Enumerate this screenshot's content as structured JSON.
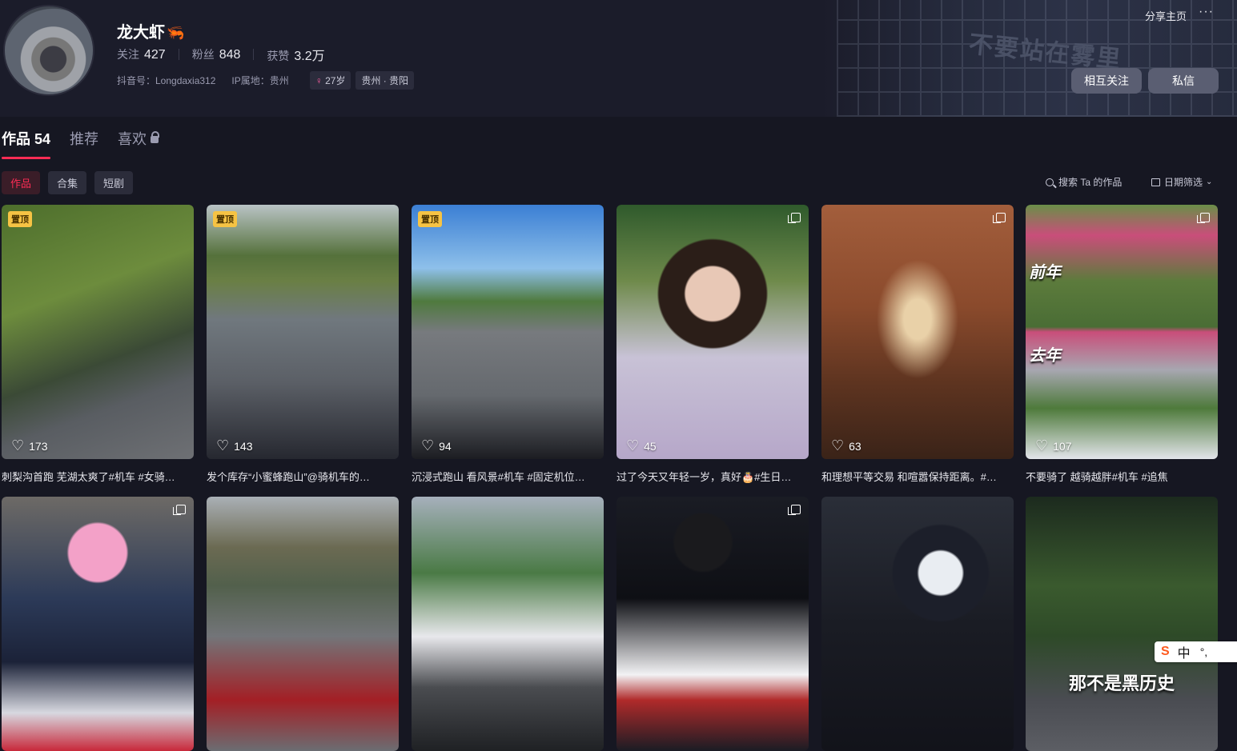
{
  "profile": {
    "name": "龙大虾",
    "following_label": "关注",
    "following": "427",
    "followers_label": "粉丝",
    "followers": "848",
    "likes_label": "获赞",
    "likes": "3.2万",
    "douyin_id": "抖音号：Longdaxia312",
    "ip": "IP属地：贵州",
    "age": "27岁",
    "location": "贵州 · 贵阳"
  },
  "banner": {
    "text": "不要站在雾里"
  },
  "header": {
    "share": "分享主页",
    "more": "···",
    "follow_button": "相互关注",
    "message_button": "私信"
  },
  "tabs": [
    {
      "label": "作品 54"
    },
    {
      "label": "推荐"
    },
    {
      "label": "喜欢"
    }
  ],
  "subtabs": [
    {
      "label": "作品"
    },
    {
      "label": "合集"
    },
    {
      "label": "短剧"
    }
  ],
  "search": {
    "label": "搜索 Ta 的作品"
  },
  "date_filter": {
    "label": "日期筛选"
  },
  "pin_label": "置顶",
  "videos": [
    {
      "likes": "173",
      "caption": "刺梨沟首跑 芜湖太爽了#机车 #女骑…"
    },
    {
      "likes": "143",
      "caption": "发个库存“小蜜蜂跑山”@骑机车的…"
    },
    {
      "likes": "94",
      "caption": "沉浸式跑山 看风景#机车 #固定机位…"
    },
    {
      "likes": "45",
      "caption": "过了今天又年轻一岁，真好🎂#生日…"
    },
    {
      "likes": "63",
      "caption": "和理想平等交易 和喧嚣保持距离。#…"
    },
    {
      "likes": "107",
      "caption": "不要骑了 越骑越胖#机车 #追焦",
      "overlay1": "前年",
      "overlay2": "去年"
    },
    {
      "likes": "",
      "caption": ""
    },
    {
      "likes": "",
      "caption": ""
    },
    {
      "likes": "",
      "caption": ""
    },
    {
      "likes": "",
      "caption": ""
    },
    {
      "likes": "",
      "caption": ""
    },
    {
      "likes": "",
      "caption": "",
      "overlay": "那不是黑历史"
    }
  ],
  "ime": {
    "logo": "S",
    "lang": "中",
    "punct": "°,"
  }
}
